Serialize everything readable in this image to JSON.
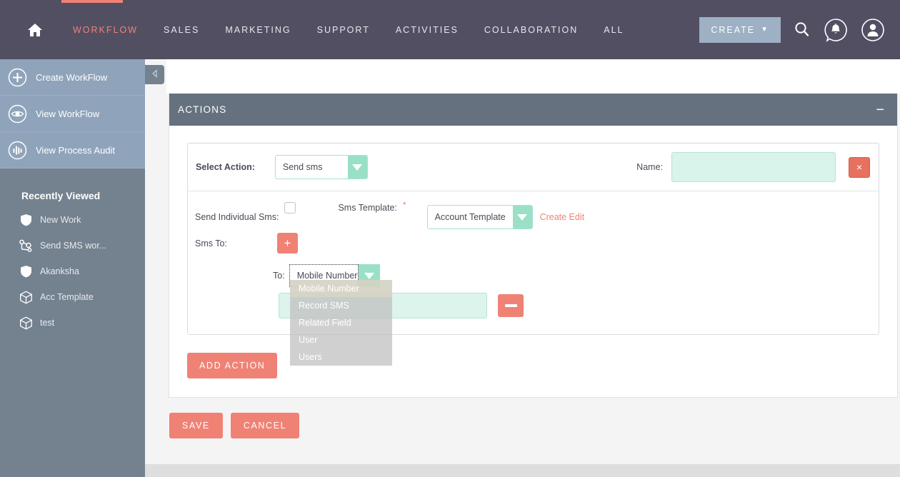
{
  "nav": {
    "home_icon": "home-icon",
    "items": [
      {
        "label": "WORKFLOW",
        "active": true
      },
      {
        "label": "SALES",
        "active": false
      },
      {
        "label": "MARKETING",
        "active": false
      },
      {
        "label": "SUPPORT",
        "active": false
      },
      {
        "label": "ACTIVITIES",
        "active": false
      },
      {
        "label": "COLLABORATION",
        "active": false
      },
      {
        "label": "ALL",
        "active": false
      }
    ],
    "create_label": "CREATE",
    "create_caret": "▼",
    "search_icon": "search-icon",
    "notifications_icon": "notification-bell-icon",
    "account_icon": "user-account-icon"
  },
  "sidebar": {
    "actions": [
      {
        "label": "Create WorkFlow",
        "icon": "plus-circle-icon"
      },
      {
        "label": "View WorkFlow",
        "icon": "eye-icon"
      },
      {
        "label": "View Process Audit",
        "icon": "audit-bars-icon"
      }
    ],
    "recent_title": "Recently Viewed",
    "recent_items": [
      {
        "label": "New Work",
        "icon": "shield-icon"
      },
      {
        "label": "Send SMS wor...",
        "icon": "workflow-node-icon"
      },
      {
        "label": "Akanksha",
        "icon": "shield-icon"
      },
      {
        "label": "Acc Template",
        "icon": "cube-icon"
      },
      {
        "label": "test",
        "icon": "cube-icon"
      }
    ],
    "collapse_icon": "chevron-left-icon"
  },
  "panel": {
    "title": "ACTIONS",
    "collapse_glyph": "−"
  },
  "action_form": {
    "select_action_label": "Select Action:",
    "select_action_value": "Send sms",
    "name_label": "Name:",
    "name_value": "",
    "name_placeholder": "",
    "close_glyph": "×",
    "send_individual_label": "Send Individual Sms:",
    "send_individual_checked": false,
    "sms_template_label": "Sms Template:",
    "sms_template_required": "*",
    "sms_template_value": "Account Template",
    "create_edit_label": "Create Edit",
    "sms_to_label": "Sms To:",
    "add_row_glyph": "+",
    "to_label": "To:",
    "to_value": "Mobile Number",
    "to_input_value": "",
    "to_input_placeholder": "",
    "remove_row_glyph": "−",
    "dropdown_options": [
      {
        "label": "Mobile Number",
        "selected": true
      },
      {
        "label": "Record SMS",
        "selected": false
      },
      {
        "label": "Related Field",
        "selected": false
      },
      {
        "label": "User",
        "selected": false
      },
      {
        "label": "Users",
        "selected": false
      }
    ],
    "add_action_label": "ADD ACTION"
  },
  "footer": {
    "save_label": "SAVE",
    "cancel_label": "CANCEL"
  },
  "colors": {
    "nav_bg": "#534f63",
    "accent_coral": "#ef8275",
    "sidebar_top": "#8fa4ba",
    "sidebar_bottom": "#74818f",
    "panel_header": "#65717f",
    "mint": "#99e0c7",
    "mint_field": "#ddf4ed",
    "create_btn": "#9db0c4"
  }
}
